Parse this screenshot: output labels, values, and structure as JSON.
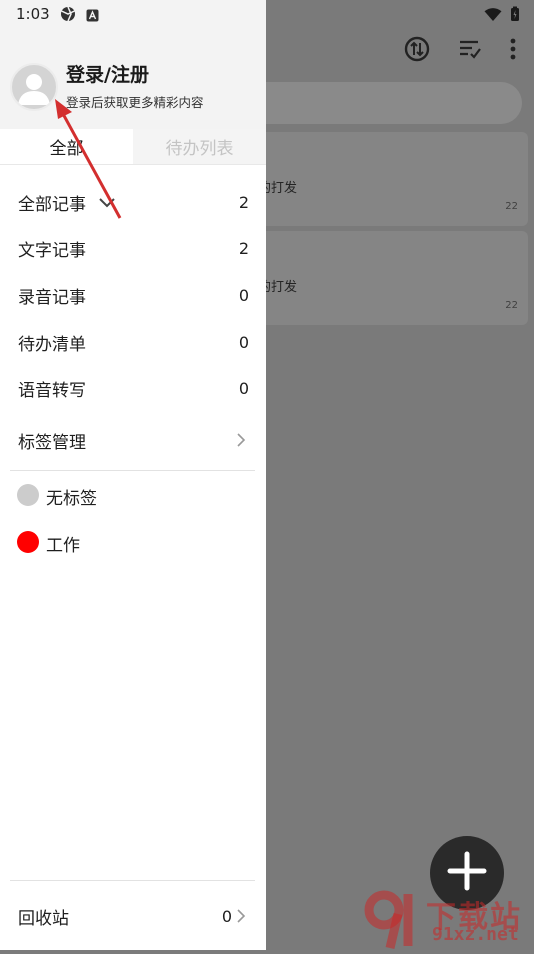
{
  "status_bar": {
    "time": "1:03"
  },
  "drawer": {
    "login_title": "登录/注册",
    "login_subtitle": "登录后获取更多精彩内容",
    "tabs": [
      {
        "label": "全部",
        "active": true
      },
      {
        "label": "待办列表",
        "active": false
      }
    ],
    "categories": [
      {
        "label": "全部记事",
        "count": "2"
      },
      {
        "label": "文字记事",
        "count": "2"
      },
      {
        "label": "录音记事",
        "count": "0"
      },
      {
        "label": "待办清单",
        "count": "0"
      },
      {
        "label": "语音转写",
        "count": "0"
      }
    ],
    "tag_manage_label": "标签管理",
    "tags": [
      {
        "label": "无标签",
        "color": "#cccccc"
      },
      {
        "label": "工作",
        "color": "#ff0000"
      }
    ],
    "recycle": {
      "label": "回收站",
      "count": "0"
    }
  },
  "background": {
    "notes": [
      {
        "text": "的打发",
        "date": "22"
      },
      {
        "text": "的打发",
        "date": "22"
      }
    ]
  },
  "watermark": {
    "main": "下载站",
    "sub": "91xz.net"
  },
  "colors": {
    "accent_red": "#d32f2f",
    "tag_work": "#ff0000",
    "tag_none": "#cccccc"
  }
}
